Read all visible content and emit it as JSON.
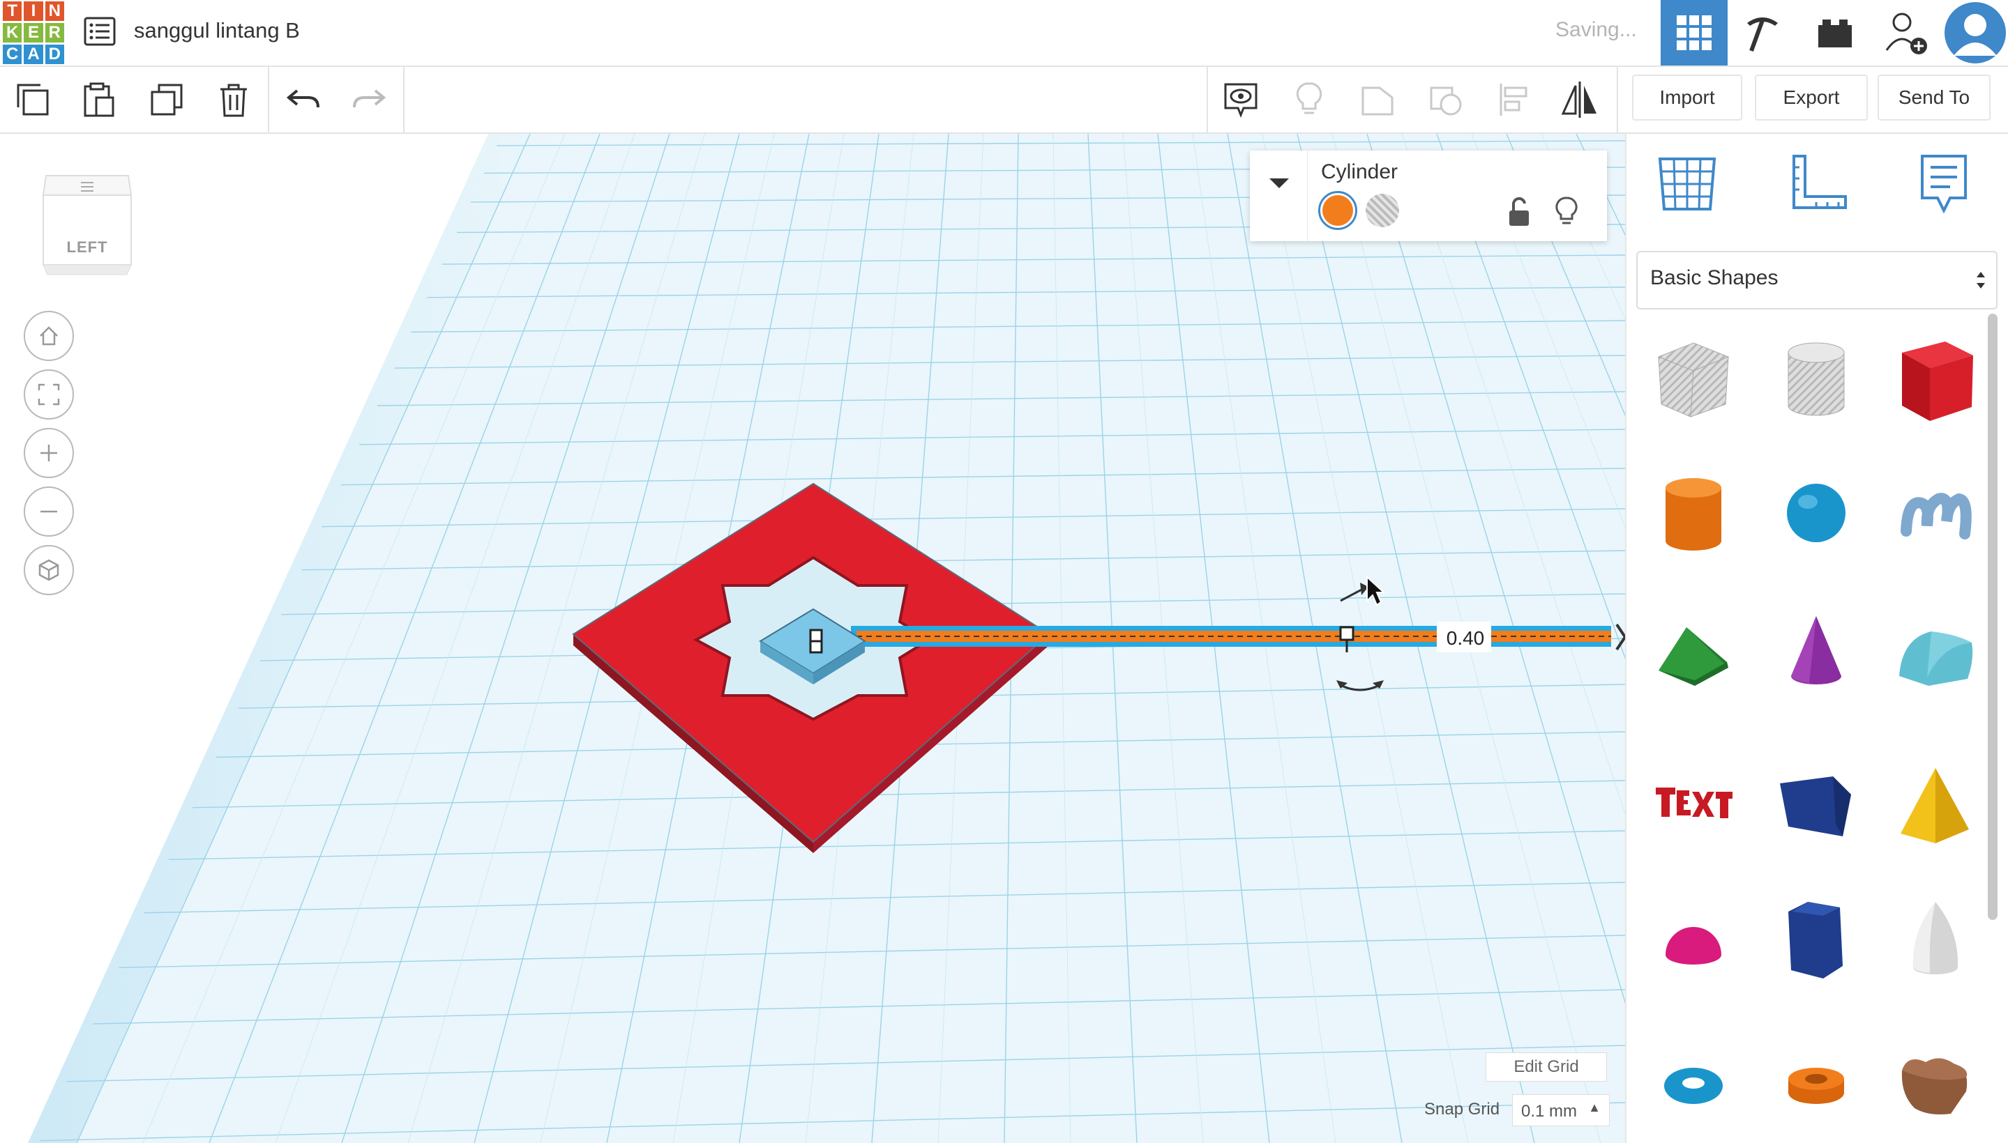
{
  "app": {
    "logo_letters": [
      "T",
      "I",
      "N",
      "K",
      "E",
      "R",
      "C",
      "A",
      "D"
    ],
    "logo_colors": [
      "#e0552b",
      "#e0552b",
      "#e0552b",
      "#86b93f",
      "#86b93f",
      "#86b93f",
      "#2e91d1",
      "#2e91d1",
      "#2e91d1"
    ],
    "project_title": "sanggul lintang B",
    "status": "Saving..."
  },
  "toolbar": {
    "import_label": "Import",
    "export_label": "Export",
    "send_to_label": "Send To"
  },
  "viewcube": {
    "face_label": "LEFT"
  },
  "inspector": {
    "shape_name": "Cylinder",
    "solid_color": "#f27d1c"
  },
  "workplane": {
    "dimension_value": "0.40",
    "edit_grid_label": "Edit Grid",
    "snap_grid_label": "Snap Grid",
    "snap_grid_value": "0.1 mm"
  },
  "library": {
    "category": "Basic Shapes",
    "shapes": [
      {
        "name": "Box Hole"
      },
      {
        "name": "Cylinder Hole"
      },
      {
        "name": "Box"
      },
      {
        "name": "Cylinder"
      },
      {
        "name": "Sphere"
      },
      {
        "name": "Scribble"
      },
      {
        "name": "Roof"
      },
      {
        "name": "Cone"
      },
      {
        "name": "Round Roof"
      },
      {
        "name": "Text"
      },
      {
        "name": "Wedge"
      },
      {
        "name": "Pyramid"
      },
      {
        "name": "Half Sphere"
      },
      {
        "name": "Polygon"
      },
      {
        "name": "Paraboloid"
      },
      {
        "name": "Torus"
      },
      {
        "name": "Tube"
      },
      {
        "name": "Heart"
      }
    ]
  },
  "colors": {
    "accent_blue": "#3f88c9",
    "shape_red": "#e01f2d",
    "grid_blue": "#8fd0ea"
  }
}
